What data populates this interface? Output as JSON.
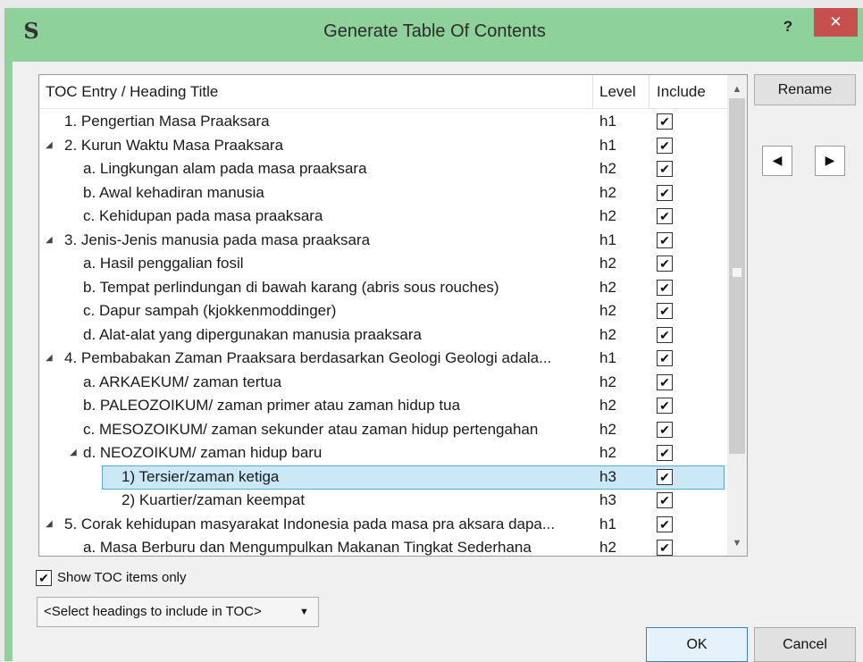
{
  "window": {
    "title": "Generate Table Of Contents",
    "app_icon": "S",
    "help_label": "?",
    "close_label": "✕"
  },
  "toc_table": {
    "columns": {
      "title": "TOC Entry / Heading Title",
      "level": "Level",
      "include": "Include"
    },
    "rows": [
      {
        "title": "1. Pengertian Masa Praaksara",
        "level": "h1",
        "expander": "",
        "include": true
      },
      {
        "title": "2. Kurun Waktu Masa Praaksara",
        "level": "h1",
        "expander": "◢",
        "include": true
      },
      {
        "title": "a. Lingkungan alam pada masa praaksara",
        "level": "h2",
        "expander": "",
        "include": true
      },
      {
        "title": "b. Awal kehadiran manusia",
        "level": "h2",
        "expander": "",
        "include": true
      },
      {
        "title": "c. Kehidupan pada masa praaksara",
        "level": "h2",
        "expander": "",
        "include": true
      },
      {
        "title": "3. Jenis-Jenis manusia pada masa praaksara",
        "level": "h1",
        "expander": "◢",
        "include": true
      },
      {
        "title": "a. Hasil penggalian fosil",
        "level": "h2",
        "expander": "",
        "include": true
      },
      {
        "title": "b. Tempat perlindungan di bawah karang (abris sous rouches)",
        "level": "h2",
        "expander": "",
        "include": true
      },
      {
        "title": "c. Dapur sampah (kjokkenmoddinger)",
        "level": "h2",
        "expander": "",
        "include": true
      },
      {
        "title": "d. Alat-alat yang dipergunakan manusia praaksara",
        "level": "h2",
        "expander": "",
        "include": true
      },
      {
        "title": "4. Pembabakan Zaman Praaksara berdasarkan Geologi Geologi adala...",
        "level": "h1",
        "expander": "◢",
        "include": true
      },
      {
        "title": "a. ARKAEKUM/ zaman tertua",
        "level": "h2",
        "expander": "",
        "include": true
      },
      {
        "title": "b. PALEOZOIKUM/ zaman primer atau zaman hidup tua",
        "level": "h2",
        "expander": "",
        "include": true
      },
      {
        "title": "c. MESOZOIKUM/ zaman sekunder atau zaman hidup pertengahan",
        "level": "h2",
        "expander": "",
        "include": true
      },
      {
        "title": "d. NEOZOIKUM/ zaman hidup baru",
        "level": "h2",
        "expander": "◢",
        "include": true
      },
      {
        "title": "1) Tersier/zaman ketiga",
        "level": "h3",
        "expander": "",
        "include": true,
        "selected": true
      },
      {
        "title": "2) Kuartier/zaman keempat",
        "level": "h3",
        "expander": "",
        "include": true
      },
      {
        "title": "5. Corak kehidupan masyarakat Indonesia pada masa pra aksara dapa...",
        "level": "h1",
        "expander": "◢",
        "include": true
      },
      {
        "title": "a. Masa Berburu dan Mengumpulkan Makanan Tingkat Sederhana",
        "level": "h2",
        "expander": "",
        "include": true
      }
    ]
  },
  "buttons": {
    "rename": "Rename",
    "ok": "OK",
    "cancel": "Cancel"
  },
  "options": {
    "show_toc_only_label": "Show TOC items only",
    "show_toc_only_checked": true,
    "heading_select_value": "<Select headings to include in TOC>"
  },
  "icons": {
    "arrow_left": "arrow-left-icon",
    "arrow_right": "arrow-right-icon",
    "expander": "collapse-triangle-icon",
    "scroll_up": "chevron-up-icon",
    "scroll_down": "chevron-down-icon"
  },
  "colors": {
    "titlebar": "#8fd19a",
    "close_button": "#c7504f",
    "selection_fill": "#cbe8f6",
    "selection_border": "#5aa7d8"
  }
}
